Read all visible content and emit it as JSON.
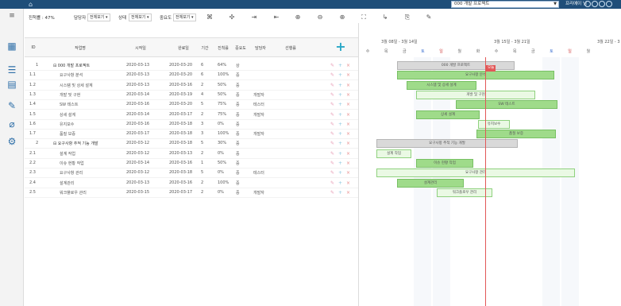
{
  "topbar": {
    "project_select": "000 개발 프로젝트",
    "user": "프리에이 님"
  },
  "toolbar": {
    "progress_label": "진척률 : 47%",
    "assignee_label": "담당자",
    "assignee_value": "전체보기 ▾",
    "status_label": "상태",
    "status_value": "전체보기 ▾",
    "importance_label": "중요도",
    "importance_value": "전체보기 ▾"
  },
  "columns": {
    "id": "ID",
    "task": "작업명",
    "start": "시작일",
    "end": "완료일",
    "duration": "기간",
    "progress": "진척률",
    "importance": "중요도",
    "assignee": "담당자",
    "predecessor": "선행률"
  },
  "rows": [
    {
      "id": "1",
      "name": "⊟ 000 개발 프로젝트",
      "start": "2020-03-13",
      "end": "2020-03-20",
      "dur": "6",
      "pct": "64%",
      "imp": "상",
      "who": ""
    },
    {
      "id": "1.1",
      "name": "요구사항 분석",
      "start": "2020-03-13",
      "end": "2020-03-20",
      "dur": "6",
      "pct": "100%",
      "imp": "중",
      "who": ""
    },
    {
      "id": "1.2",
      "name": "시스템 및 상세 설계",
      "start": "2020-03-13",
      "end": "2020-03-16",
      "dur": "2",
      "pct": "50%",
      "imp": "중",
      "who": ""
    },
    {
      "id": "1.3",
      "name": "개발 및 구현",
      "start": "2020-03-14",
      "end": "2020-03-19",
      "dur": "4",
      "pct": "50%",
      "imp": "중",
      "who": "개발자"
    },
    {
      "id": "1.4",
      "name": "SW 테스트",
      "start": "2020-03-16",
      "end": "2020-03-20",
      "dur": "5",
      "pct": "75%",
      "imp": "중",
      "who": "테스터"
    },
    {
      "id": "1.5",
      "name": "상세 설계",
      "start": "2020-03-14",
      "end": "2020-03-17",
      "dur": "2",
      "pct": "75%",
      "imp": "중",
      "who": "개발자"
    },
    {
      "id": "1.6",
      "name": "유지보수",
      "start": "2020-03-16",
      "end": "2020-03-18",
      "dur": "3",
      "pct": "0%",
      "imp": "중",
      "who": ""
    },
    {
      "id": "1.7",
      "name": "품질 보증",
      "start": "2020-03-17",
      "end": "2020-03-18",
      "dur": "3",
      "pct": "100%",
      "imp": "중",
      "who": "개발자"
    },
    {
      "id": "2",
      "name": "⊟ 요구사항 추적 기능 개발",
      "start": "2020-03-12",
      "end": "2020-03-18",
      "dur": "5",
      "pct": "30%",
      "imp": "중",
      "who": ""
    },
    {
      "id": "2.1",
      "name": "설계 작업",
      "start": "2020-03-12",
      "end": "2020-03-13",
      "dur": "2",
      "pct": "0%",
      "imp": "중",
      "who": ""
    },
    {
      "id": "2.2",
      "name": "이슈 현황 작업",
      "start": "2020-03-14",
      "end": "2020-03-16",
      "dur": "1",
      "pct": "50%",
      "imp": "중",
      "who": ""
    },
    {
      "id": "2.3",
      "name": "요구사항 관리",
      "start": "2020-03-12",
      "end": "2020-03-18",
      "dur": "5",
      "pct": "0%",
      "imp": "중",
      "who": "테스터"
    },
    {
      "id": "2.4",
      "name": "설계관리",
      "start": "2020-03-13",
      "end": "2020-03-16",
      "dur": "2",
      "pct": "100%",
      "imp": "중",
      "who": ""
    },
    {
      "id": "2.5",
      "name": "워크플로우 관리",
      "start": "2020-03-15",
      "end": "2020-03-17",
      "dur": "2",
      "pct": "0%",
      "imp": "중",
      "who": "개발자"
    }
  ],
  "gantt": {
    "week1": "3월 08일 - 3월 14일",
    "week2": "3월 15일 - 3월 21일",
    "week3": "3월 22일 - 3",
    "days": [
      "수",
      "목",
      "금",
      "토",
      "일",
      "월",
      "화",
      "수",
      "목",
      "금",
      "토",
      "일",
      "월"
    ],
    "bars": [
      {
        "label": "000 개발 프로젝트",
        "type": "sum"
      },
      {
        "label": "요구사항 분석",
        "type": "prog"
      },
      {
        "label": "시스템 및 상세 설계",
        "type": "prog"
      },
      {
        "label": "개발 및 구현",
        "type": "task"
      },
      {
        "label": "SW 테스트",
        "type": "prog"
      },
      {
        "label": "상세 설계",
        "type": "prog"
      },
      {
        "label": "유지보수",
        "type": "task"
      },
      {
        "label": "품질 보증",
        "type": "prog"
      },
      {
        "label": "요구사항 추적 기능 개발",
        "type": "sum"
      },
      {
        "label": "설계 작업",
        "type": "task"
      },
      {
        "label": "이슈 현황 작업",
        "type": "prog"
      },
      {
        "label": "요구사항 관리",
        "type": "task"
      },
      {
        "label": "설계관리",
        "type": "prog"
      },
      {
        "label": "워크플로우 관리",
        "type": "task"
      }
    ],
    "today_label": "오늘"
  }
}
